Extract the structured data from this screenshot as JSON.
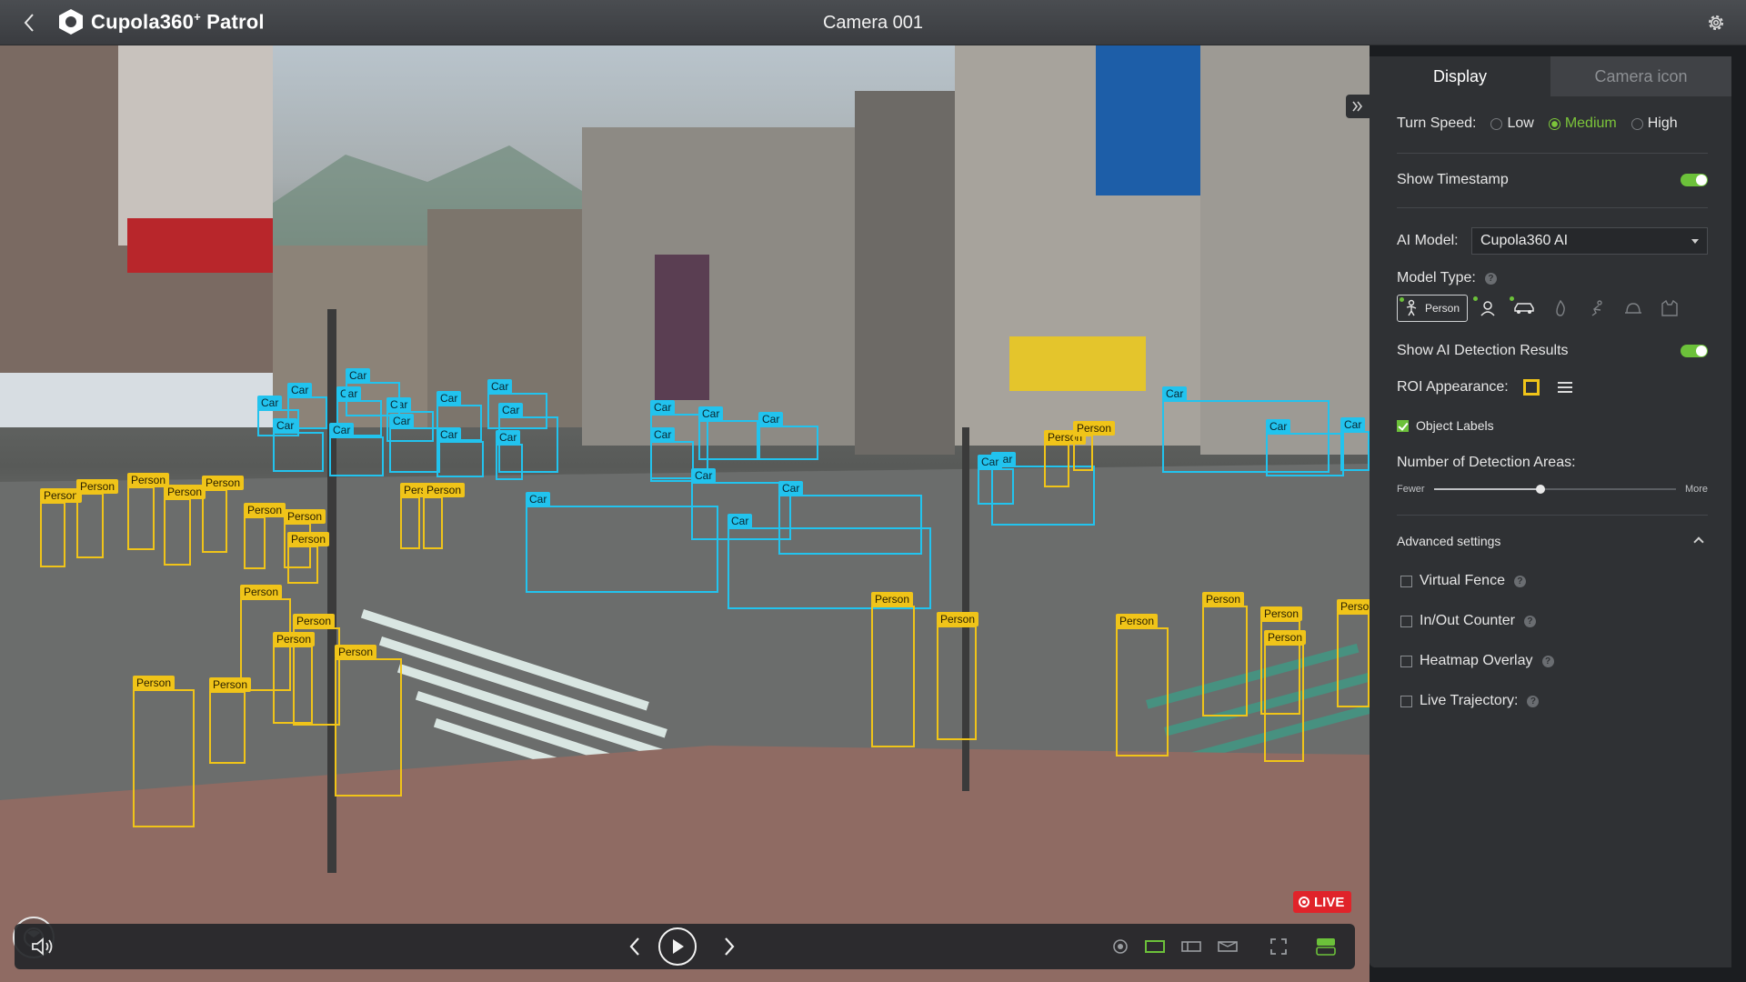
{
  "app": {
    "brand": "Cupola360",
    "brand_sup": "+",
    "brand_suffix": " Patrol",
    "camera_title": "Camera 001"
  },
  "icons": {
    "back": "chevron-left-icon",
    "logo": "hexagon-logo-icon",
    "settings": "gear-icon",
    "ptz": "ptz-joystick-icon",
    "volume": "speaker-icon",
    "prev": "chevron-left-icon",
    "play": "play-icon",
    "next": "chevron-right-icon",
    "collapse": "double-chevron-right-icon"
  },
  "colors": {
    "accent_green": "#6cc13a",
    "car_box": "#22c3ee",
    "person_box": "#f0c419",
    "live_red": "#e0232a"
  },
  "video": {
    "live_label": "LIVE",
    "detections": {
      "cars": [
        {
          "label": "Car"
        },
        {
          "label": "Car"
        },
        {
          "label": "Car"
        },
        {
          "label": "Car"
        },
        {
          "label": "Car"
        },
        {
          "label": "Car"
        },
        {
          "label": "Car"
        },
        {
          "label": "Car"
        },
        {
          "label": "Car"
        },
        {
          "label": "Car"
        },
        {
          "label": "Car"
        },
        {
          "label": "Car"
        },
        {
          "label": "Car"
        },
        {
          "label": "Car"
        },
        {
          "label": "Car"
        },
        {
          "label": "Car"
        },
        {
          "label": "Car"
        },
        {
          "label": "Car"
        },
        {
          "label": "Car"
        },
        {
          "label": "Car"
        },
        {
          "label": "Car"
        },
        {
          "label": "Car"
        },
        {
          "label": "Car"
        },
        {
          "label": "Car"
        },
        {
          "label": "Car"
        },
        {
          "label": "Car"
        }
      ],
      "persons": [
        {
          "label": "Person"
        },
        {
          "label": "Person"
        },
        {
          "label": "Person"
        },
        {
          "label": "Person"
        },
        {
          "label": "Person"
        },
        {
          "label": "Person"
        },
        {
          "label": "Person"
        },
        {
          "label": "Person"
        },
        {
          "label": "Person"
        },
        {
          "label": "Person"
        },
        {
          "label": "Person"
        },
        {
          "label": "Person"
        },
        {
          "label": "Person"
        },
        {
          "label": "Person"
        },
        {
          "label": "Person"
        },
        {
          "label": "Person"
        },
        {
          "label": "Person"
        },
        {
          "label": "Person"
        },
        {
          "label": "Person"
        },
        {
          "label": "Person"
        },
        {
          "label": "Person"
        },
        {
          "label": "Person"
        },
        {
          "label": "Person"
        },
        {
          "label": "Person"
        },
        {
          "label": "Person"
        }
      ]
    }
  },
  "controls": {
    "toolbar_icons": [
      "snapshot-icon",
      "roi-rect-icon",
      "roi-strip-icon",
      "roi-region-icon",
      "fullscreen-icon",
      "layout-toggle-icon"
    ]
  },
  "panel": {
    "tabs": [
      {
        "label": "Display",
        "active": true
      },
      {
        "label": "Camera icon",
        "active": false
      }
    ],
    "turn_speed": {
      "label": "Turn Speed:",
      "options": [
        "Low",
        "Medium",
        "High"
      ],
      "selected": "Medium"
    },
    "show_timestamp": {
      "label": "Show Timestamp",
      "on": true
    },
    "ai_model": {
      "label": "AI Model:",
      "value": "Cupola360 AI"
    },
    "model_type": {
      "label": "Model Type:",
      "first": "Person",
      "icons": [
        "person-icon",
        "face-icon",
        "car-icon",
        "fire-icon",
        "fall-icon",
        "helmet-icon",
        "vest-icon"
      ]
    },
    "show_ai_results": {
      "label": "Show AI Detection Results",
      "on": true
    },
    "roi_appearance": {
      "label": "ROI Appearance:"
    },
    "object_labels": {
      "label": "Object Labels",
      "checked": true
    },
    "detection_areas": {
      "label": "Number of Detection Areas:",
      "min_label": "Fewer",
      "max_label": "More",
      "value_fraction": 0.44
    },
    "advanced": {
      "label": "Advanced settings",
      "items": [
        {
          "label": "Virtual Fence",
          "checked": false
        },
        {
          "label": "In/Out Counter",
          "checked": false
        },
        {
          "label": "Heatmap Overlay",
          "checked": false
        },
        {
          "label": "Live Trajectory:",
          "checked": false
        }
      ]
    }
  }
}
